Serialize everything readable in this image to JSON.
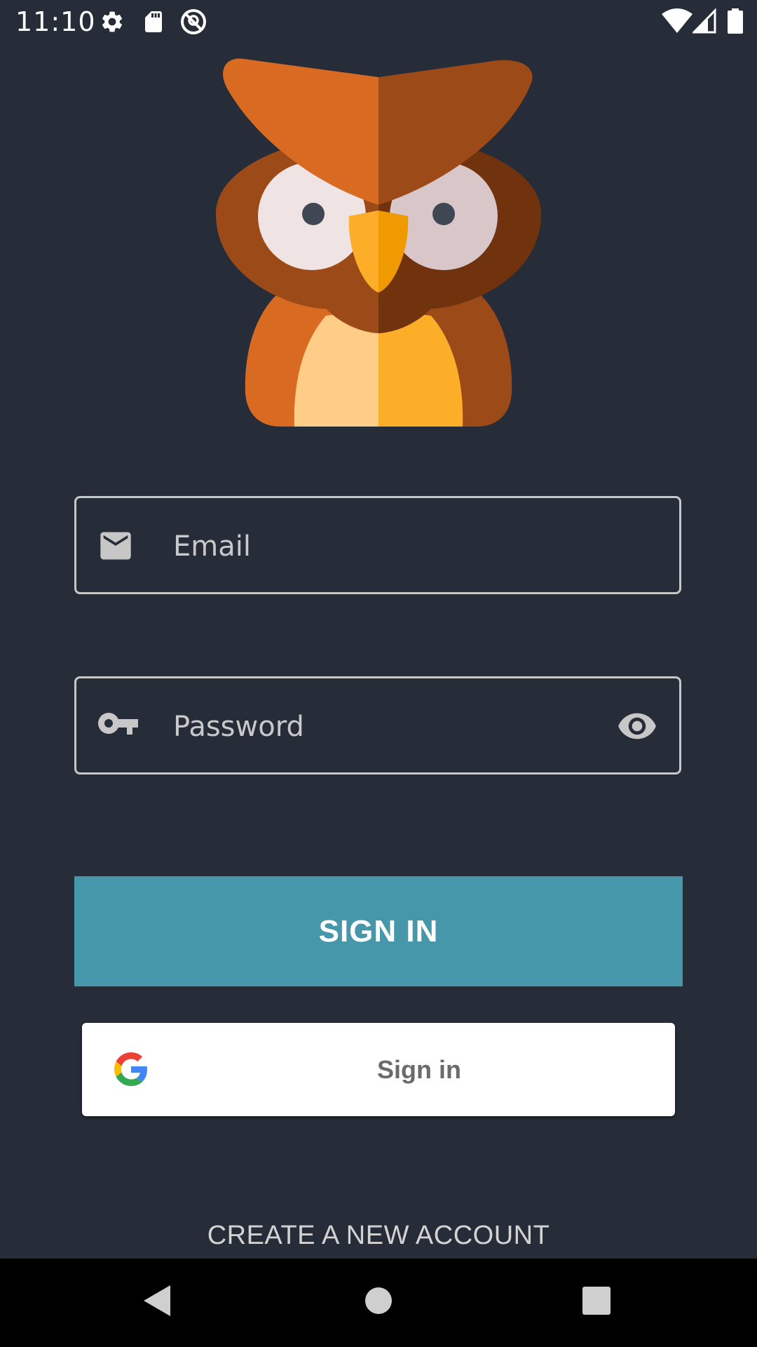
{
  "status_bar": {
    "time": "11:10",
    "left_icons": [
      "gear-icon",
      "sd-card-icon",
      "no-location-icon"
    ],
    "right_icons": [
      "wifi-icon",
      "cellular-signal-icon",
      "battery-icon"
    ]
  },
  "logo": {
    "icon": "owl-logo-icon"
  },
  "email_field": {
    "icon": "mail-icon",
    "placeholder": "Email",
    "value": ""
  },
  "password_field": {
    "icon": "key-icon",
    "placeholder": "Password",
    "value": "",
    "toggle_icon": "eye-icon"
  },
  "sign_in_button": {
    "label": "SIGN IN",
    "color": "#4797ab"
  },
  "google_button": {
    "icon": "google-g-icon",
    "label": "Sign in"
  },
  "create_account": {
    "label": "CREATE A NEW ACCOUNT"
  },
  "nav_bar": {
    "icons": [
      "back-icon",
      "home-icon",
      "recents-icon"
    ]
  },
  "colors": {
    "background": "#262d38",
    "accent": "#4797ab",
    "owl_orange": "#d96a22"
  }
}
